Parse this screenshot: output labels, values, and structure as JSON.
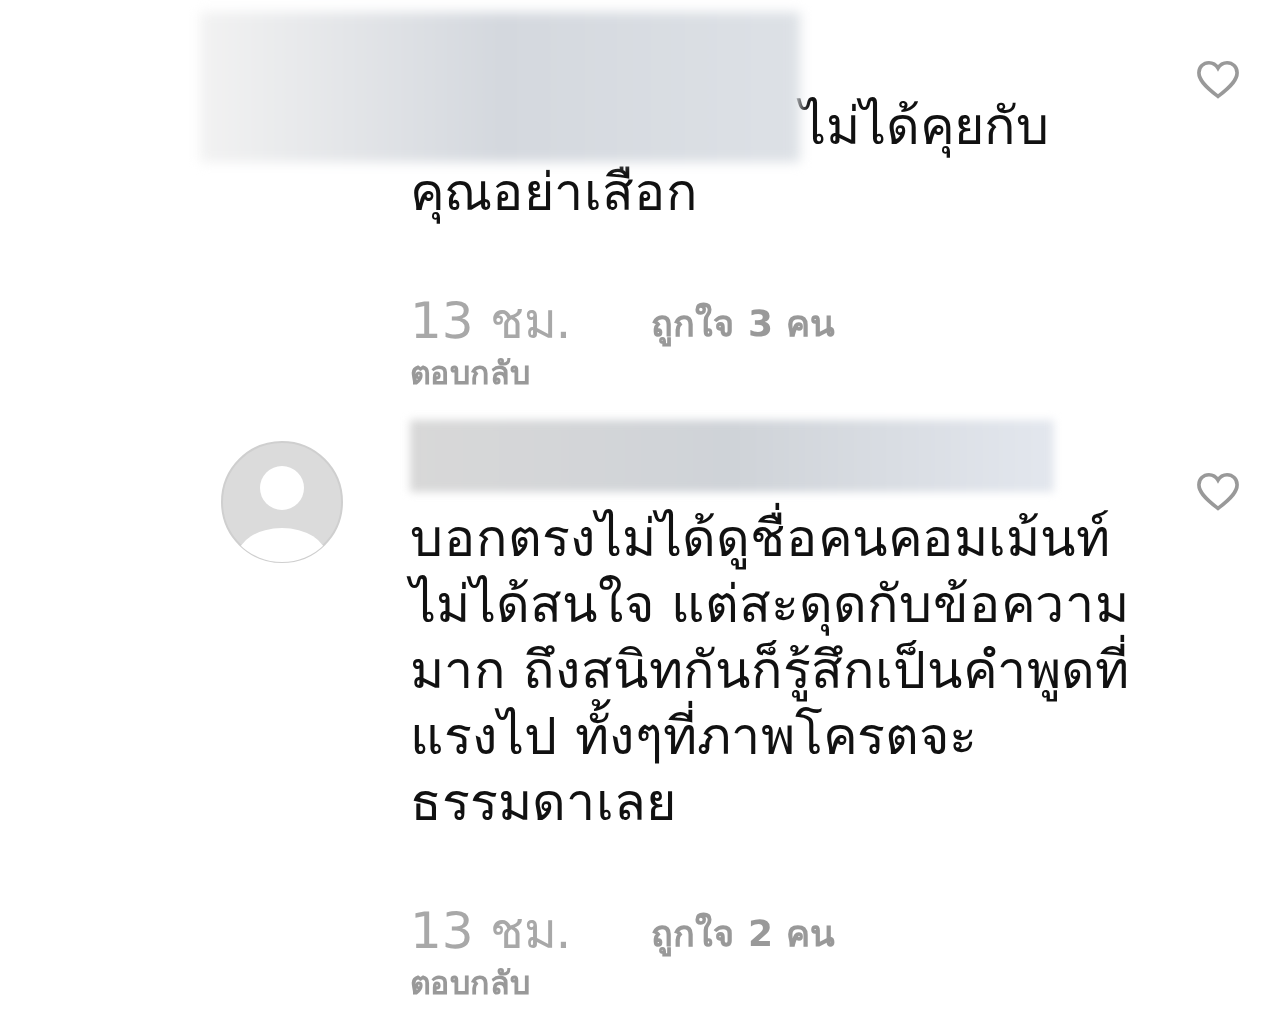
{
  "comments": [
    {
      "kind": "redacted_avatar",
      "lines": [
        "ไม่ได้คุยกับ",
        "คุณอย่าเสือก"
      ],
      "time": "13 ชม.",
      "likes": "ถูกใจ 3 คน",
      "reply": "ตอบกลับ",
      "liked": false
    },
    {
      "kind": "avatar",
      "lines": [
        "บอกตรงไม่ได้ดูชื่อคนคอมเม้นท์",
        "ไม่ได้สนใจ แต่สะดุดกับข้อความ",
        "มาก ถึงสนิทกันก็รู้สึกเป็นคำพูดที่",
        "แรงไป ทั้งๆที่ภาพโครตจะ",
        "ธรรมดาเลย"
      ],
      "time": "13 ชม.",
      "likes": "ถูกใจ 2 คน",
      "reply": "ตอบกลับ",
      "liked": false
    }
  ]
}
